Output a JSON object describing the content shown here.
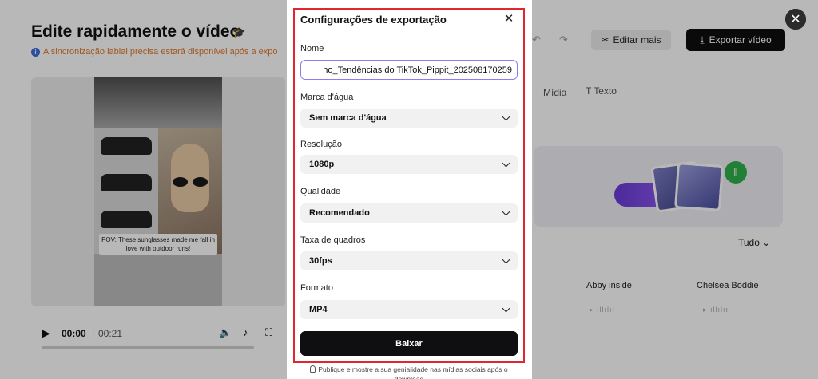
{
  "editor": {
    "title": "Edite rapidamente o vídeo",
    "sync_note": "A sincronização labial precisa estará disponível após a expo",
    "edit_more_label": "Editar mais",
    "export_label": "Exportar vídeo",
    "preview_caption": "POV: These sunglasses made me fall in love with outdoor runs!",
    "current_time": "00:00",
    "total_time": "00:21",
    "tabs": {
      "media": "Mídia",
      "text": "Texto"
    },
    "filter": "Tudo",
    "voices": [
      "Abby inside",
      "Chelsea Boddie"
    ]
  },
  "modal": {
    "title": "Configurações de exportação",
    "name": {
      "label": "Nome",
      "value": "ho_Tendências do TikTok_Pippit_202508170259"
    },
    "watermark": {
      "label": "Marca d'água",
      "value": "Sem marca d'água"
    },
    "resolution": {
      "label": "Resolução",
      "value": "1080p"
    },
    "quality": {
      "label": "Qualidade",
      "value": "Recomendado"
    },
    "framerate": {
      "label": "Taxa de quadros",
      "value": "30fps"
    },
    "format": {
      "label": "Formato",
      "value": "MP4"
    },
    "download_label": "Baixar",
    "footer_note": "Publique e mostre a sua genialidade nas mídias sociais após o",
    "footer_note_2": "download"
  },
  "colors": {
    "highlight_border": "#e0262e",
    "input_focus": "#8b7ff0",
    "primary_button": "#0f0f12"
  }
}
